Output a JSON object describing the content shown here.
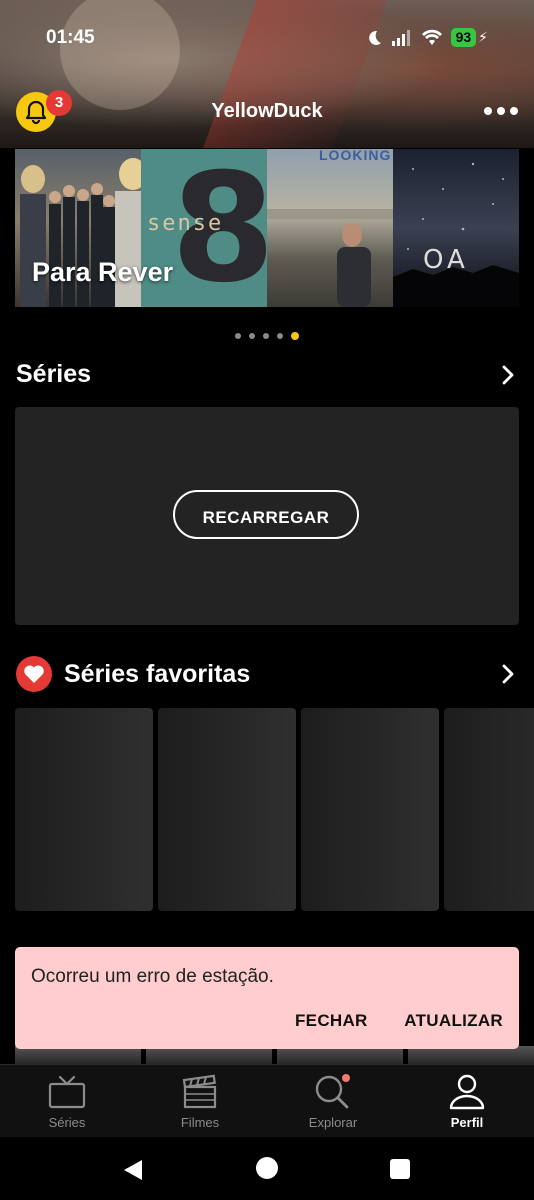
{
  "status_bar": {
    "time": "01:45",
    "battery": "93"
  },
  "app_bar": {
    "title": "YellowDuck",
    "notification_count": "3"
  },
  "carousel": {
    "label": "Para Rever",
    "posters": [
      {
        "name": "ensemble-poster"
      },
      {
        "name": "sense8-poster",
        "text": "sense",
        "digit": "8"
      },
      {
        "name": "looking-poster",
        "text": "LOOKING"
      },
      {
        "name": "oa-poster",
        "text": "OA"
      }
    ],
    "page_count": 5,
    "active_page": 5
  },
  "series_section": {
    "title": "Séries",
    "reload_label": "RECARREGAR"
  },
  "favorites_section": {
    "title": "Séries favoritas"
  },
  "snackbar": {
    "message": "Ocorreu um erro de estação.",
    "close_label": "FECHAR",
    "refresh_label": "ATUALIZAR"
  },
  "bottom_nav": {
    "items": [
      {
        "label": "Séries",
        "icon": "tv-icon"
      },
      {
        "label": "Filmes",
        "icon": "clapperboard-icon"
      },
      {
        "label": "Explorar",
        "icon": "search-icon"
      },
      {
        "label": "Perfil",
        "icon": "person-icon"
      }
    ],
    "active": "Perfil"
  },
  "colors": {
    "accent": "#f6c90e",
    "badge": "#e53935",
    "snackbar_bg": "#ffcdcd",
    "card_bg": "#232323"
  }
}
